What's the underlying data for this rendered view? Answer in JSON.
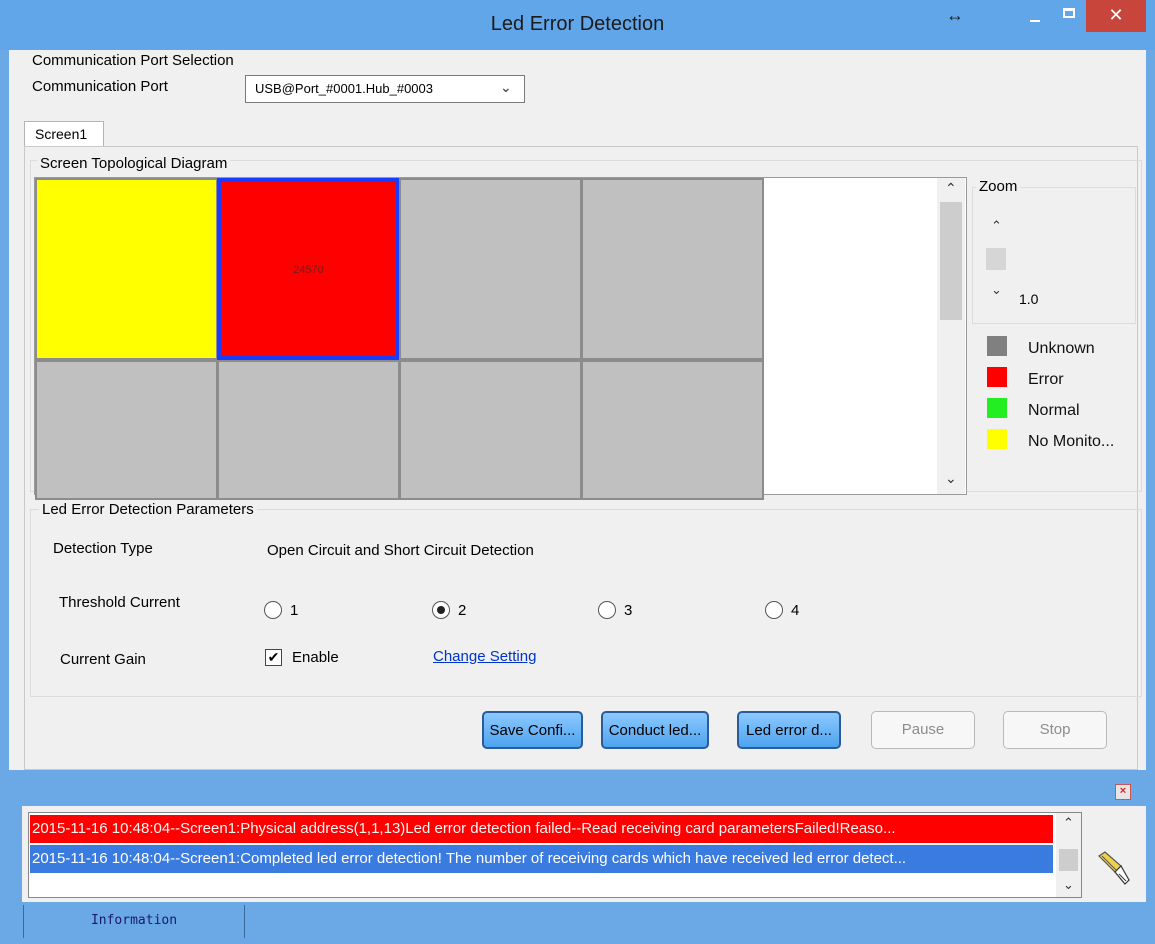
{
  "window": {
    "title": "Led Error Detection",
    "icons": [
      "resize-arrows-icon",
      "minimize-icon",
      "maximize-icon",
      "close-icon"
    ]
  },
  "port_section": {
    "title": "Communication Port Selection",
    "label": "Communication Port",
    "selected": "USB@Port_#0001.Hub_#0003"
  },
  "tabs": [
    "Screen1"
  ],
  "topology": {
    "title": "Screen Topological Diagram",
    "cells": [
      {
        "status": "no_monitor",
        "label": ""
      },
      {
        "status": "error",
        "label": "24570",
        "selected": true
      },
      {
        "status": "unknown",
        "label": ""
      },
      {
        "status": "unknown",
        "label": ""
      },
      {
        "status": "unknown",
        "label": ""
      },
      {
        "status": "unknown",
        "label": ""
      },
      {
        "status": "unknown",
        "label": ""
      },
      {
        "status": "unknown",
        "label": ""
      }
    ]
  },
  "zoom": {
    "title": "Zoom",
    "value": "1.0"
  },
  "legend": [
    {
      "label": "Unknown",
      "color": "#808080"
    },
    {
      "label": "Error",
      "color": "#ff0000"
    },
    {
      "label": "Normal",
      "color": "#22ee22"
    },
    {
      "label": "No Monito...",
      "color": "#ffff00"
    }
  ],
  "params": {
    "title": "Led Error Detection Parameters",
    "detection_type_label": "Detection Type",
    "detection_type_value": "Open Circuit and Short Circuit Detection",
    "threshold_label": "Threshold Current",
    "threshold_options": [
      "1",
      "2",
      "3",
      "4"
    ],
    "threshold_selected": "2",
    "gain_label": "Current Gain",
    "gain_enable_label": "Enable",
    "gain_enabled": true,
    "change_setting_link": "Change Setting"
  },
  "buttons": {
    "save": "Save Confi...",
    "conduct": "Conduct led...",
    "led_error": "Led error d...",
    "pause": "Pause",
    "stop": "Stop"
  },
  "log": {
    "lines": [
      {
        "text": "2015-11-16 10:48:04--Screen1:Physical address(1,1,13)Led error detection failed--Read receiving card parametersFailed!Reaso...",
        "color": "#ff0000"
      },
      {
        "text": "2015-11-16 10:48:04--Screen1:Completed led error detection! The number of receiving cards which have received led error detect...",
        "color": "#3a7be0"
      }
    ],
    "status_tab": "Information"
  }
}
